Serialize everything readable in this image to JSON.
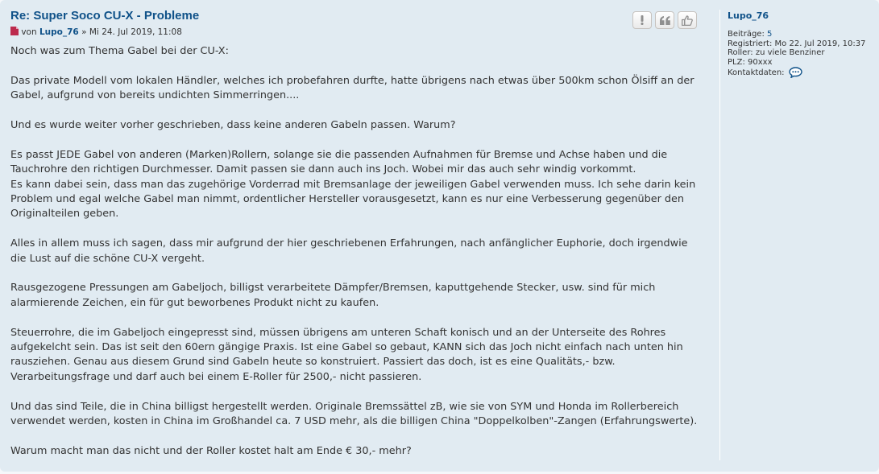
{
  "post": {
    "title": "Re: Super Soco CU-X - Probleme",
    "by": "von",
    "author": "Lupo_76",
    "separator": "»",
    "date": "Mi 24. Jul 2019, 11:08",
    "paragraphs": [
      [
        "Noch was zum Thema Gabel bei der CU-X:"
      ],
      [
        "Das private Modell vom lokalen Händler, welches ich probefahren durfte, hatte übrigens nach etwas über 500km schon Ölsiff an der Gabel, aufgrund von bereits undichten Simmerringen...."
      ],
      [
        "Und es wurde weiter vorher geschrieben, dass keine anderen Gabeln passen. Warum?"
      ],
      [
        "Es passt JEDE Gabel von anderen (Marken)Rollern, solange sie die passenden Aufnahmen für Bremse und Achse haben und die Tauchrohre den richtigen Durchmesser. Damit passen sie dann auch ins Joch. Wobei mir das auch sehr windig vorkommt.",
        "Es kann dabei sein, dass man das zugehörige Vorderrad mit Bremsanlage der jeweiligen Gabel verwenden muss. Ich sehe darin kein Problem und egal welche Gabel man nimmt, ordentlicher Hersteller vorausgesetzt, kann es nur eine Verbesserung gegenüber den Originalteilen geben."
      ],
      [
        "Alles in allem muss ich sagen, dass mir aufgrund der hier geschriebenen Erfahrungen, nach anfänglicher Euphorie, doch irgendwie die Lust auf die schöne CU-X vergeht."
      ],
      [
        "Rausgezogene Pressungen am Gabeljoch, billigst verarbeitete Dämpfer/Bremsen, kaputtgehende Stecker, usw. sind für mich alarmierende Zeichen, ein für gut beworbenes Produkt nicht zu kaufen."
      ],
      [
        "Steuerrohre, die im Gabeljoch eingepresst sind, müssen übrigens am unteren Schaft konisch und an der Unterseite des Rohres aufgekelcht sein. Das ist seit den 60ern gängige Praxis. Ist eine Gabel so gebaut, KANN sich das Joch nicht einfach nach unten hin rausziehen. Genau aus diesem Grund sind Gabeln heute so konstruiert. Passiert das doch, ist es eine Qualitäts,- bzw. Verarbeitungsfrage und darf auch bei einem E-Roller für 2500,- nicht passieren."
      ],
      [
        "Und das sind Teile, die in China billigst hergestellt werden. Originale Bremssättel zB, wie sie von SYM und Honda im Rollerbereich verwendet werden, kosten in China im Großhandel ca. 7 USD mehr, als die billigen China \"Doppelkolben\"-Zangen (Erfahrungswerte)."
      ],
      [
        "Warum macht man das nicht und der Roller kostet halt am Ende € 30,- mehr?"
      ]
    ]
  },
  "actions": [
    {
      "name": "report-button",
      "icon": "exclamation-icon"
    },
    {
      "name": "quote-button",
      "icon": "quote-icon"
    },
    {
      "name": "like-button",
      "icon": "thumbs-up-icon"
    }
  ],
  "profile": {
    "username": "Lupo_76",
    "posts_label": "Beiträge:",
    "posts_value": "5",
    "registered_label": "Registriert:",
    "registered_value": "Mo 22. Jul 2019, 10:37",
    "roller_label": "Roller:",
    "roller_value": "zu viele Benziner",
    "plz_label": "PLZ:",
    "plz_value": "90xxx",
    "contact_label": "Kontaktdaten:",
    "contact_icon": "speech-bubble-icon"
  },
  "colors": {
    "post_background": "#e1ebf2",
    "link": "#105289",
    "post_icon": "#bc2a4d",
    "contact_icon": "#105289"
  }
}
